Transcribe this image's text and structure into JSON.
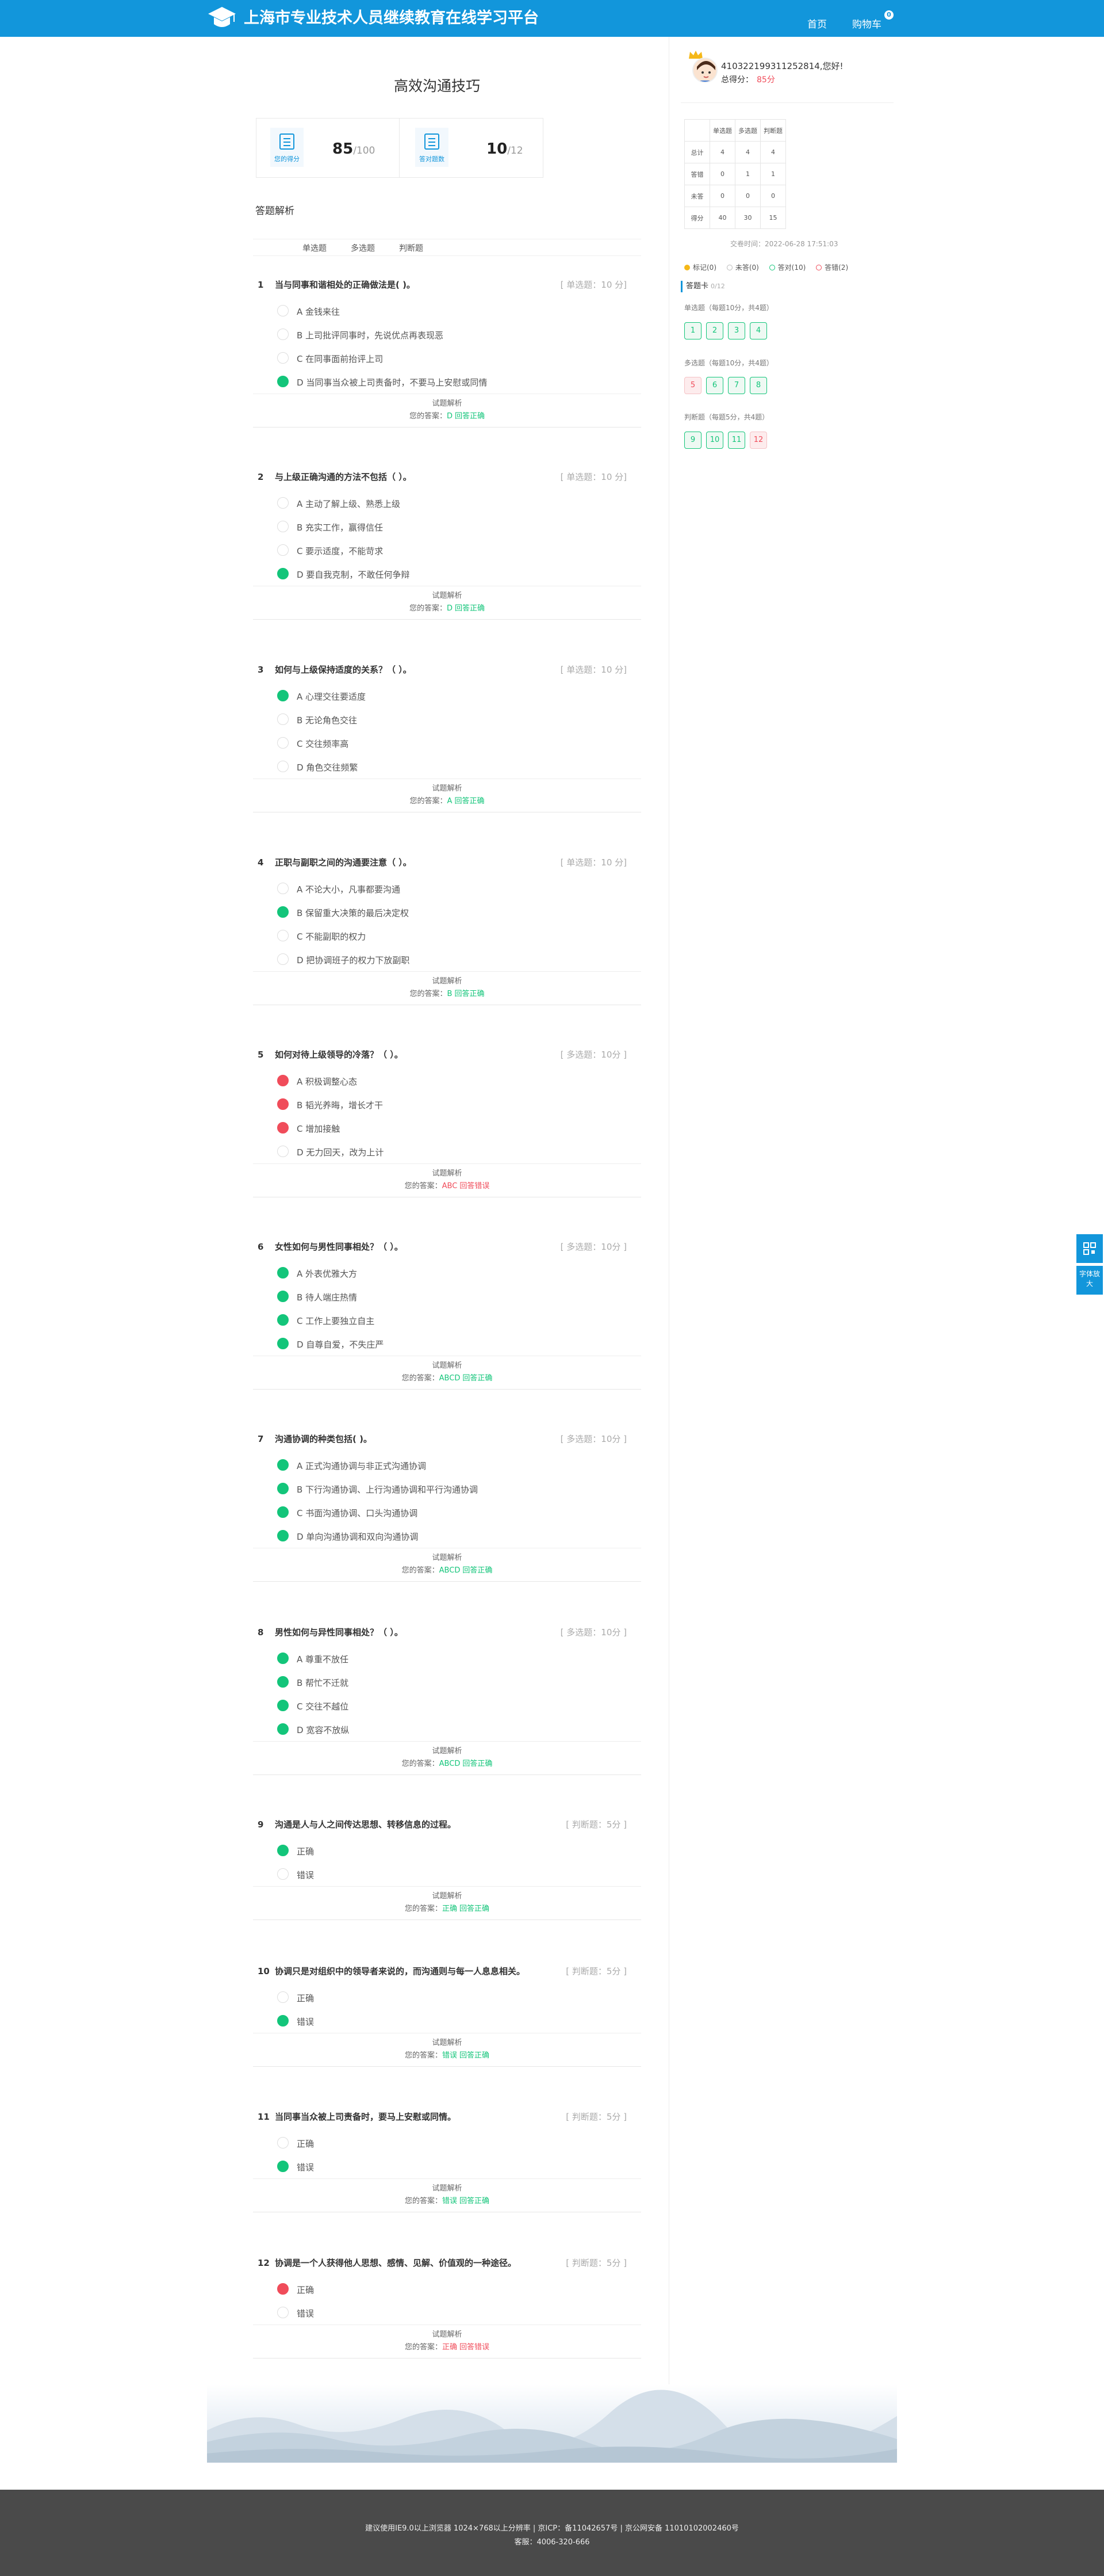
{
  "header": {
    "site_title": "上海市专业技术人员继续教育在线学习平台",
    "nav_home": "首页",
    "nav_cart": "购物车",
    "cart_count": "0"
  },
  "exam": {
    "title": "高效沟通技巧",
    "score_label": "您的得分",
    "score_value": "85",
    "score_total": "/100",
    "correct_label": "答对题数",
    "correct_value": "10",
    "correct_total": "/12"
  },
  "section_title": "答题解析",
  "tabs": [
    "单选题",
    "多选题",
    "判断题"
  ],
  "analysis_label": "试题解析",
  "answer_prefix": "您的答案：",
  "questions": [
    {
      "num": "1",
      "title": "当与同事和谐相处的正确做法是(      )。",
      "tag": "[ 单选题：10 分]",
      "options": [
        "A  金钱来往",
        "B  上司批评同事时，先说优点再表现恶",
        "C  在同事面前抬评上司",
        "D  当同事当众被上司责备时，不要马上安慰或同情"
      ],
      "answer": "D",
      "result": "回答正确"
    },
    {
      "num": "2",
      "title": "与上级正确沟通的方法不包括（ ）。",
      "tag": "[ 单选题：10 分]",
      "options": [
        "A  主动了解上级、熟悉上级",
        "B  充实工作，赢得信任",
        "C  要示适度，不能苛求",
        "D  要自我克制，不敢任何争辩"
      ],
      "answer": "D",
      "result": "回答正确"
    },
    {
      "num": "3",
      "title": "如何与上级保持适度的关系？（ ）。",
      "tag": "[ 单选题：10 分]",
      "options": [
        "A  心理交往要适度",
        "B  无论角色交往",
        "C  交往频率高",
        "D  角色交往频繁"
      ],
      "answer": "A",
      "result": "回答正确"
    },
    {
      "num": "4",
      "title": "正职与副职之间的沟通要注意（ ）。",
      "tag": "[ 单选题：10 分]",
      "options": [
        "A  不论大小，凡事都要沟通",
        "B  保留重大决策的最后决定权",
        "C  不能副职的权力",
        "D  把协调班子的权力下放副职"
      ],
      "answer": "B",
      "result": "回答正确"
    },
    {
      "num": "5",
      "title": "如何对待上级领导的冷落？（ ）。",
      "tag": "[ 多选题：10分 ]",
      "options": [
        "A  积极调整心态",
        "B  韬光养晦，增长才干",
        "C  增加接触",
        "D  无力回天，改为上计"
      ],
      "answer": "ABC",
      "result": "回答错误"
    },
    {
      "num": "6",
      "title": "女性如何与男性同事相处？（ ）。",
      "tag": "[ 多选题：10分 ]",
      "options": [
        "A  外表优雅大方",
        "B  待人端庄热情",
        "C  工作上要独立自主",
        "D  自尊自爱，不失庄严"
      ],
      "answer": "ABCD",
      "result": "回答正确"
    },
    {
      "num": "7",
      "title": "沟通协调的种类包括(      )。",
      "tag": "[ 多选题：10分 ]",
      "options": [
        "A  正式沟通协调与非正式沟通协调",
        "B  下行沟通协调、上行沟通协调和平行沟通协调",
        "C  书面沟通协调、口头沟通协调",
        "D  单向沟通协调和双向沟通协调"
      ],
      "answer": "ABCD",
      "result": "回答正确"
    },
    {
      "num": "8",
      "title": "男性如何与异性同事相处？（ ）。",
      "tag": "[ 多选题：10分 ]",
      "options": [
        "A  尊重不放任",
        "B  帮忙不迁就",
        "C  交往不越位",
        "D  宽容不放纵"
      ],
      "answer": "ABCD",
      "result": "回答正确"
    },
    {
      "num": "9",
      "title": "沟通是人与人之间传达思想、转移信息的过程。",
      "tag": "[ 判断题：5分 ]",
      "options": [
        "正确",
        "错误"
      ],
      "answer": "正确",
      "result": "回答正确"
    },
    {
      "num": "10",
      "title": "协调只是对组织中的领导者来说的，而沟通则与每一人息息相关。",
      "tag": "[ 判断题：5分 ]",
      "options": [
        "正确",
        "错误"
      ],
      "answer": "错误",
      "result": "回答正确"
    },
    {
      "num": "11",
      "title": "当同事当众被上司责备时，要马上安慰或同情。",
      "tag": "[ 判断题：5分 ]",
      "options": [
        "正确",
        "错误"
      ],
      "answer": "错误",
      "result": "回答正确"
    },
    {
      "num": "12",
      "title": "协调是一个人获得他人思想、感情、见解、价值观的一种途径。",
      "tag": "[ 判断题：5分 ]",
      "options": [
        "正确",
        "错误"
      ],
      "answer": "正确",
      "result": "回答错误"
    }
  ],
  "sidebar": {
    "user_name": "410322199311252814,您好!",
    "total_score_label": "总得分：",
    "total_score_value": "85分",
    "stat_headers": [
      "",
      "单选题",
      "多选题",
      "判断题"
    ],
    "stat_rows": [
      [
        "总计",
        "4",
        "4",
        "4"
      ],
      [
        "答错",
        "0",
        "1",
        "1"
      ],
      [
        "未答",
        "0",
        "0",
        "0"
      ],
      [
        "得分",
        "40",
        "30",
        "15"
      ]
    ],
    "submit_time": "交卷时间：2022-06-28 17:51:03",
    "legend": [
      "标记(0)",
      "未答(0)",
      "答对(10)",
      "答错(2)"
    ],
    "card_title": "答题卡",
    "card_progress": "0/12",
    "groups": [
      {
        "title": "单选题（每题10分，共4题）",
        "items": [
          "1",
          "2",
          "3",
          "4"
        ]
      },
      {
        "title": "多选题（每题10分，共4题）",
        "items": [
          "5",
          "6",
          "7",
          "8"
        ]
      },
      {
        "title": "判断题（每题5分，共4题）",
        "items": [
          "9",
          "10",
          "11",
          "12"
        ]
      }
    ],
    "float_text": "字体放大"
  },
  "footer": {
    "line1": "建议使用IE9.0以上浏览器 1024×768以上分辨率 | 京ICP：备11042657号 | 京公网安备 11010102002460号",
    "line2": "客服：4006-320-666"
  },
  "colors": {
    "brand": "#1296db",
    "correct": "#13c57a",
    "wrong": "#f04c5a"
  }
}
